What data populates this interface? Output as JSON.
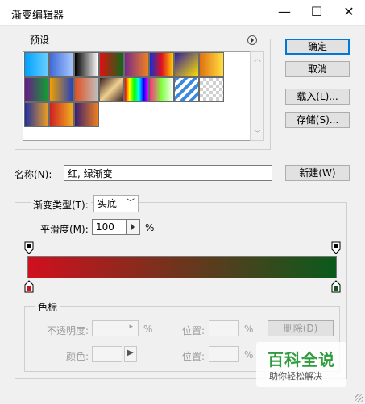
{
  "window": {
    "title": "渐变编辑器",
    "minimize": "—",
    "maximize": "☐",
    "close": "✕"
  },
  "presets": {
    "label": "预设",
    "swatches": [
      {
        "name": "preset-1",
        "css": "linear-gradient(to right,#00a0ff,#6bd0ff)"
      },
      {
        "name": "preset-2",
        "css": "linear-gradient(to right,#3f6ad8,#a8c8ff)"
      },
      {
        "name": "preset-3",
        "css": "linear-gradient(to right,#000000,#ffffff)"
      },
      {
        "name": "preset-4",
        "css": "linear-gradient(to right,#e01010,#0d6a18)"
      },
      {
        "name": "preset-5",
        "css": "linear-gradient(to right,#7a2a8a,#f08020)"
      },
      {
        "name": "preset-6",
        "css": "linear-gradient(to right,#1030d0,#e01020,#ffd000)"
      },
      {
        "name": "preset-7",
        "css": "linear-gradient(135deg,#3020a0,#ffe000)"
      },
      {
        "name": "preset-8",
        "css": "linear-gradient(to right,#e07010,#ffe040)"
      },
      {
        "name": "preset-9",
        "css": "linear-gradient(to right,#6a1a8a,#10a030)"
      },
      {
        "name": "preset-10",
        "css": "linear-gradient(to right,#f0a000,#2040c0)"
      },
      {
        "name": "preset-11",
        "css": "linear-gradient(to right,#e05020,#c0c0c0)"
      },
      {
        "name": "preset-12",
        "css": "linear-gradient(135deg,#3a2020,#f0d090,#3a2020)"
      },
      {
        "name": "preset-13",
        "css": "linear-gradient(to right,#ff0000,#ffff00,#00ff00,#00ffff,#0000ff,#ff00ff)"
      },
      {
        "name": "preset-14",
        "css": "linear-gradient(to right,#ff3080,#80ff40,#ffffff)"
      },
      {
        "name": "preset-15",
        "css": "repeating-linear-gradient(135deg,#3a8be0 0 4px,#ffffff 4px 8px)"
      },
      {
        "name": "preset-16",
        "css": "repeating-conic-gradient(#d0d0d0 0 25%,#ffffff 0 50%) 0 0/8px 8px"
      },
      {
        "name": "preset-17",
        "css": "linear-gradient(to right,#2030a0,#f0a020)"
      },
      {
        "name": "preset-18",
        "css": "linear-gradient(to right,#d02020,#f0b020)"
      },
      {
        "name": "preset-19",
        "css": "linear-gradient(to right,#3a2070,#f08020)"
      }
    ]
  },
  "buttons": {
    "ok": "确定",
    "cancel": "取消",
    "load": "载入(L)...",
    "save": "存储(S)...",
    "new": "新建(W)",
    "delete": "删除(D)"
  },
  "name_field": {
    "label": "名称(N):",
    "value": "红, 绿渐变"
  },
  "gradient": {
    "type_label": "渐变类型(T):",
    "type_value": "实底",
    "smoothness_label": "平滑度(M):",
    "smoothness_value": "100",
    "smoothness_unit": "%",
    "start_color": "#d0101e",
    "end_color": "#0a5a1c"
  },
  "color_stops": {
    "label": "色标",
    "opacity_label": "不透明度:",
    "opacity_unit": "%",
    "location_label_1": "位置:",
    "location_unit_1": "%",
    "color_label": "颜色:",
    "location_label_2": "位置:",
    "location_unit_2": "%"
  },
  "watermark": {
    "main": "百科全说",
    "sub": "助你轻松解决"
  }
}
